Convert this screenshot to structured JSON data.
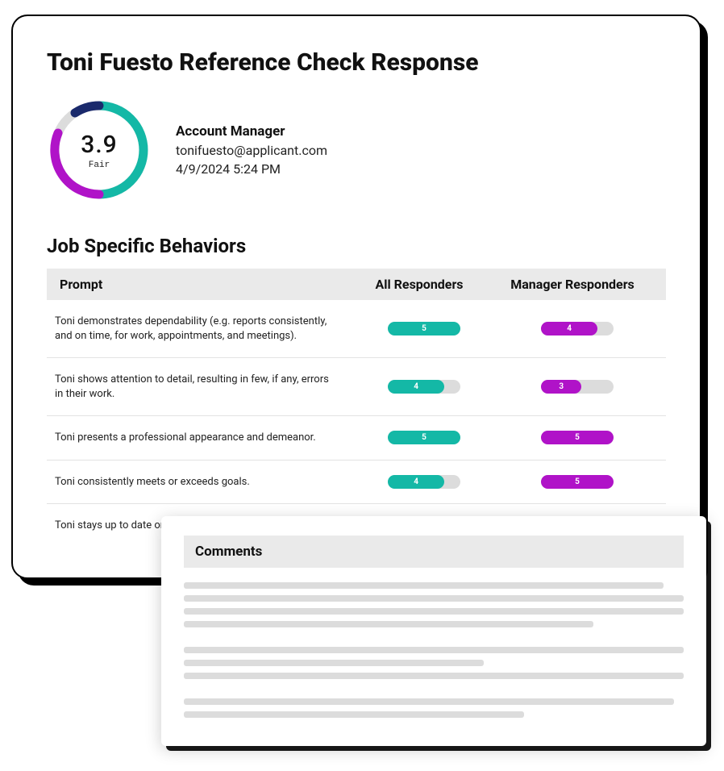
{
  "title": "Toni Fuesto Reference Check Response",
  "score": {
    "value": "3.9",
    "label": "Fair"
  },
  "applicant": {
    "role": "Account Manager",
    "email": "tonifuesto@applicant.com",
    "datetime": "4/9/2024  5:24 PM"
  },
  "section_title": "Job Specific Behaviors",
  "columns": {
    "prompt": "Prompt",
    "all": "All Responders",
    "mgr": "Manager Responders"
  },
  "rows": [
    {
      "prompt": "Toni demonstrates dependability (e.g. reports consistently, and on time, for work, appointments, and meetings).",
      "all": "5",
      "mgr": "4"
    },
    {
      "prompt": "Toni shows attention to detail, resulting in few, if any, errors in their work.",
      "all": "4",
      "mgr": "3"
    },
    {
      "prompt": "Toni presents a professional appearance and demeanor.",
      "all": "5",
      "mgr": "5"
    },
    {
      "prompt": "Toni consistently meets or exceeds goals.",
      "all": "4",
      "mgr": "5"
    },
    {
      "prompt": "Toni stays up to date on c",
      "all": "",
      "mgr": ""
    }
  ],
  "comments": {
    "header": "Comments"
  },
  "colors": {
    "teal": "#14b8a6",
    "magenta": "#b013c8",
    "track": "#dcdcdc"
  }
}
